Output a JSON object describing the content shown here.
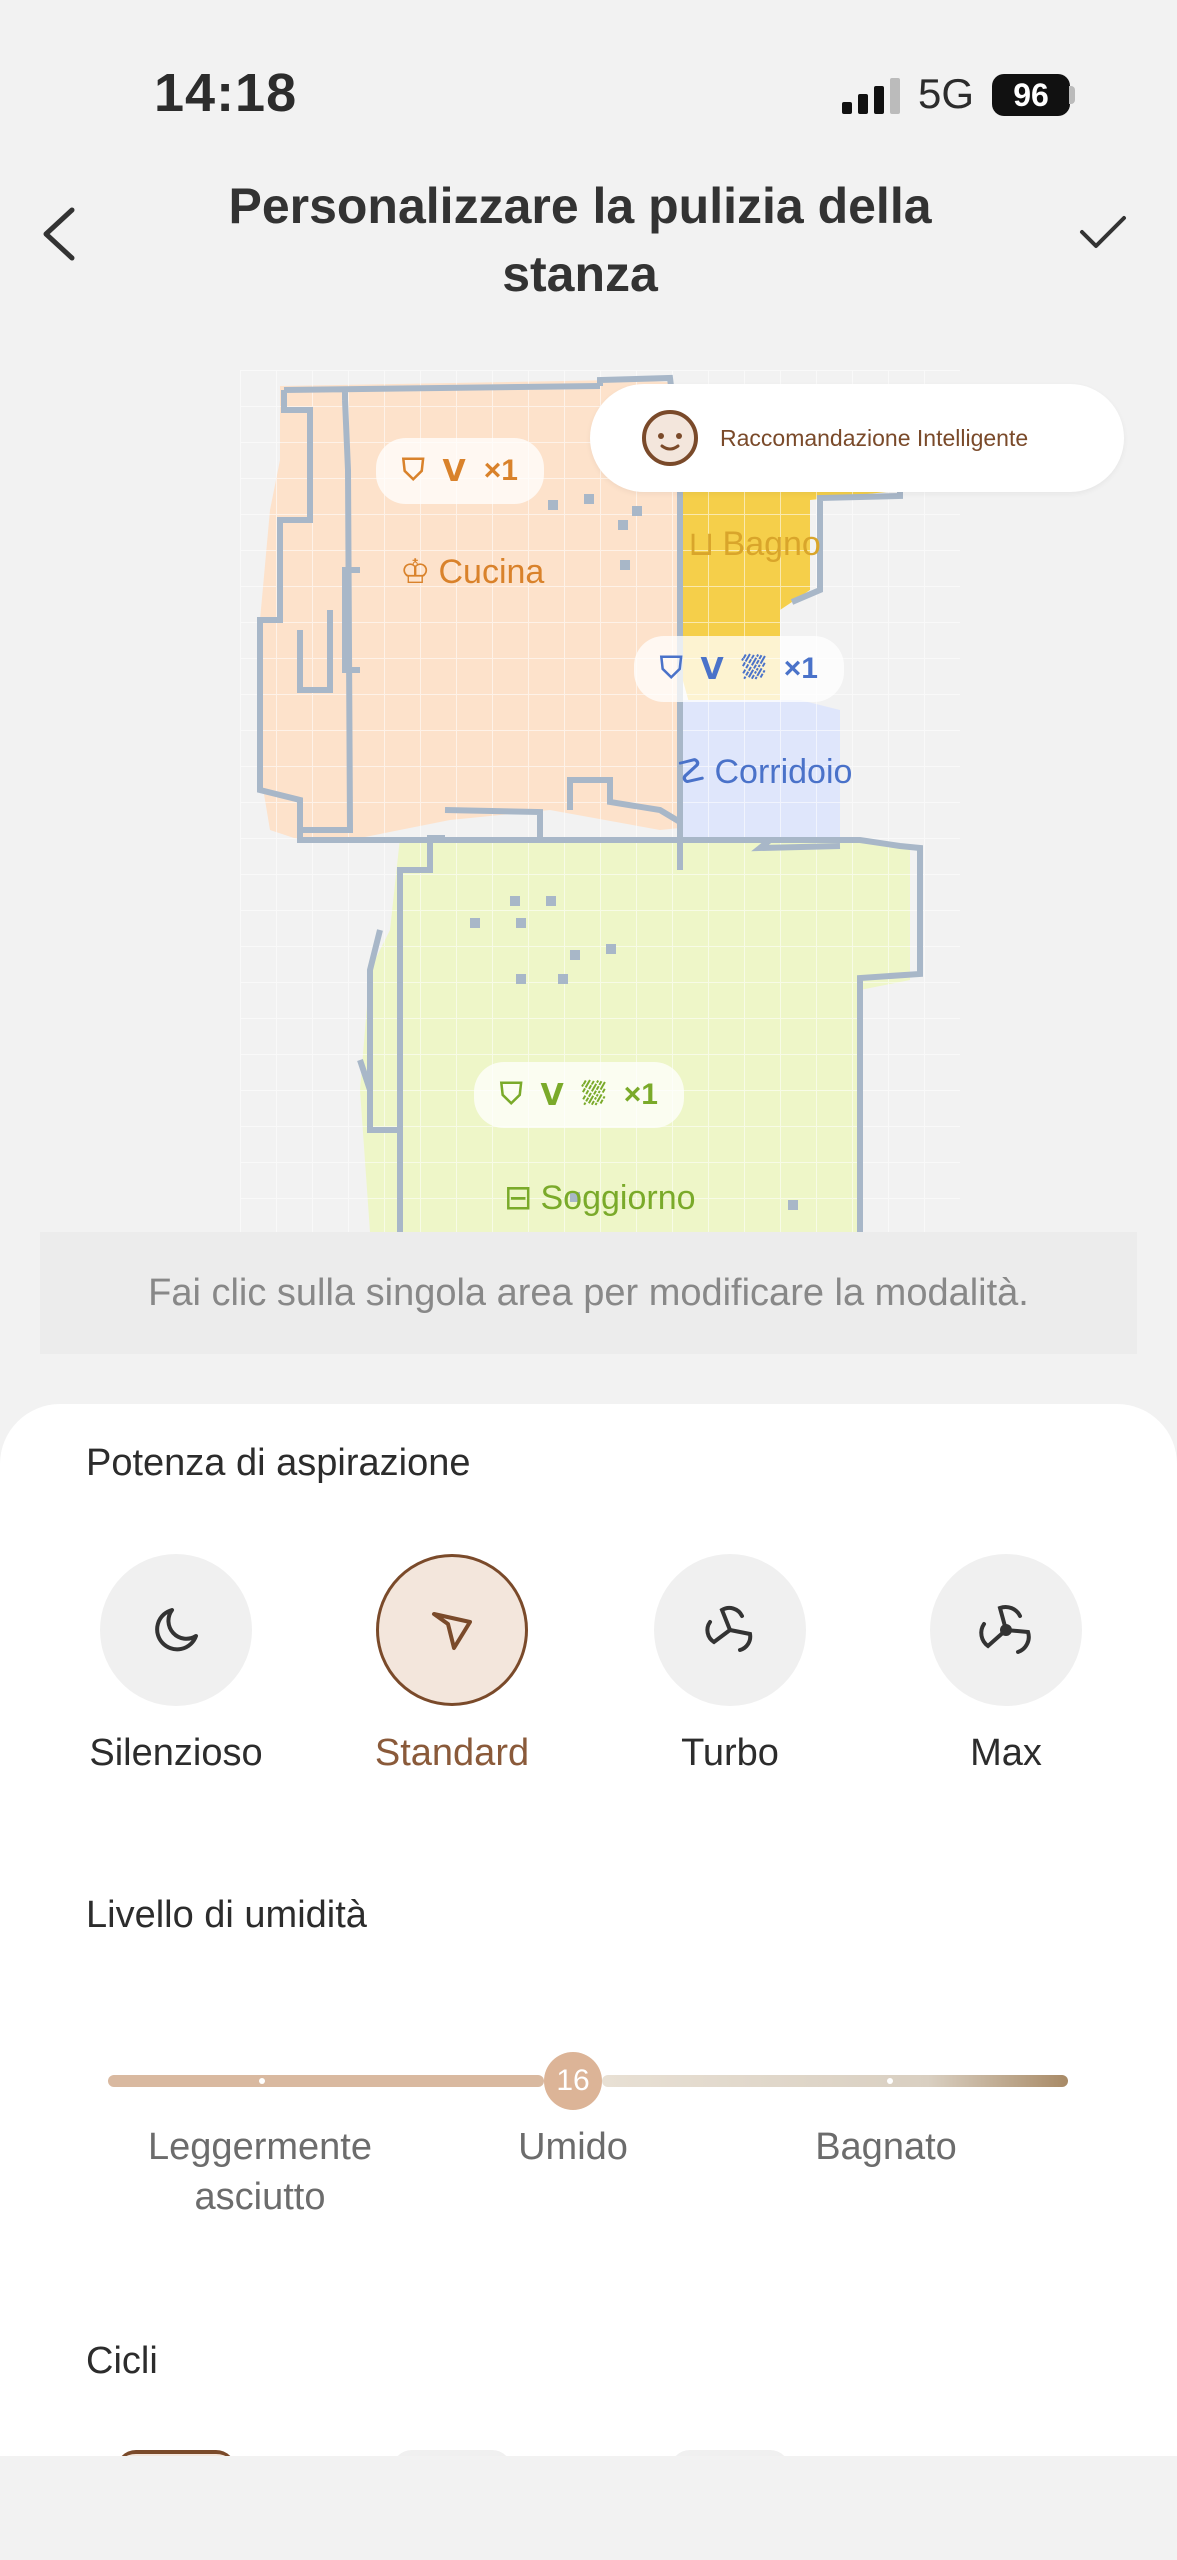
{
  "status_bar": {
    "time": "14:18",
    "network": "5G",
    "battery": "96"
  },
  "header": {
    "title": "Personalizzare la pulizia della stanza",
    "back_icon": "chevron-left-icon",
    "confirm_icon": "checkmark-icon"
  },
  "map": {
    "smart_recommendation": "Raccomandazione Intelligente",
    "rooms": [
      {
        "name": "Cucina",
        "color": "#fde2cb",
        "accent": "#d9822b",
        "bubble_count": "×1"
      },
      {
        "name": "Bagno",
        "color": "#f5cf4a",
        "accent": "#d9a52b"
      },
      {
        "name": "Corridoio",
        "color": "#dfe6fb",
        "accent": "#4a72c9",
        "bubble_count": "×1"
      },
      {
        "name": "Soggiorno",
        "color": "#eef6c8",
        "accent": "#7aaa2a",
        "bubble_count": "×1"
      }
    ]
  },
  "hint": "Fai clic sulla singola area per modificare la modalità.",
  "suction": {
    "title": "Potenza di aspirazione",
    "modes": [
      {
        "label": "Silenzioso",
        "icon": "moon-icon",
        "selected": false
      },
      {
        "label": "Standard",
        "icon": "fan-standard-icon",
        "selected": true
      },
      {
        "label": "Turbo",
        "icon": "fan-turbo-icon",
        "selected": false
      },
      {
        "label": "Max",
        "icon": "fan-max-icon",
        "selected": false
      }
    ]
  },
  "humidity": {
    "title": "Livello di umidità",
    "value": "16",
    "labels": [
      "Leggermente\nasciutto",
      "Umido",
      "Bagnato"
    ],
    "label_lines": [
      [
        "Leggermente",
        "asciutto"
      ],
      [
        "Umido"
      ],
      [
        "Bagnato"
      ]
    ]
  },
  "cycles": {
    "title": "Cicli"
  },
  "colors": {
    "accent_brown": "#7a4a2a",
    "slider_fill": "#d9b9a0"
  }
}
